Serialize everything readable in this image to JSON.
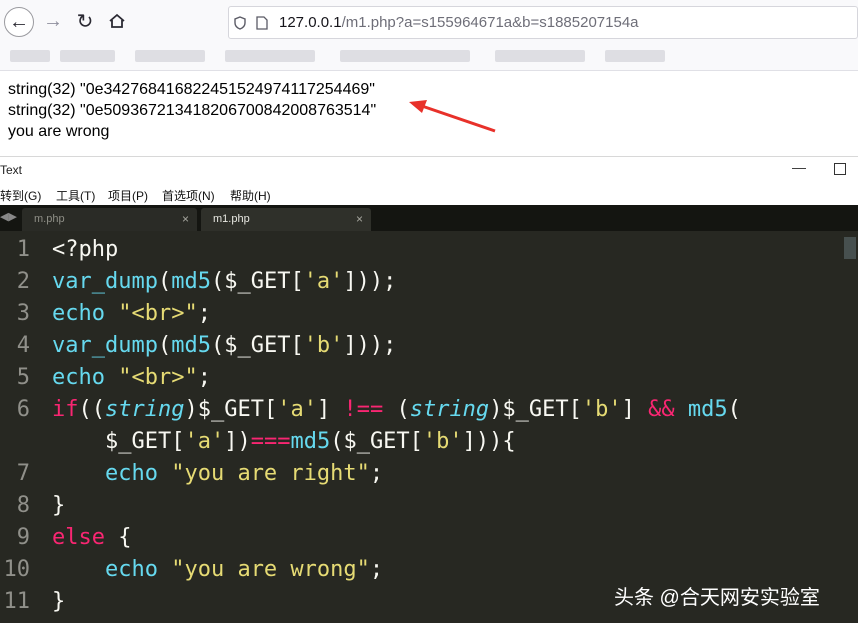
{
  "browser": {
    "url_host": "127.0.0.1",
    "url_path": "/m1.php?a=s155964671a&b=s1885207154a"
  },
  "output": {
    "line1": "string(32) \"0e342768416822451524974117254469\"",
    "line2": "string(32) \"0e509367213418206700842008763514\"",
    "line3": "you are wrong"
  },
  "editor": {
    "window_title": "Text",
    "menu": [
      "转到(G)",
      "工具(T)",
      "项目(P)",
      "首选项(N)",
      "帮助(H)"
    ],
    "tabs": [
      {
        "label": "m.php",
        "active": false
      },
      {
        "label": "m1.php",
        "active": true
      }
    ],
    "line_numbers": [
      "1",
      "2",
      "3",
      "4",
      "5",
      "6",
      "7",
      "8",
      "9",
      "10",
      "11"
    ],
    "code_lines": [
      "<?php",
      "var_dump(md5($_GET['a']));",
      "echo \"<br>\";",
      "var_dump(md5($_GET['b']));",
      "echo \"<br>\";",
      "if((string)$_GET['a'] !== (string)$_GET['b'] && md5(",
      "    $_GET['a'])===md5($_GET['b'])){",
      "    echo \"you are right\";",
      "}",
      "else {",
      "    echo \"you are wrong\";",
      "}"
    ]
  },
  "watermark": "头条 @合天网安实验室",
  "colors": {
    "editor_bg": "#272822",
    "keyword": "#f92672",
    "function": "#66d9ef",
    "string": "#e6db74",
    "arrow": "#e8312a"
  }
}
